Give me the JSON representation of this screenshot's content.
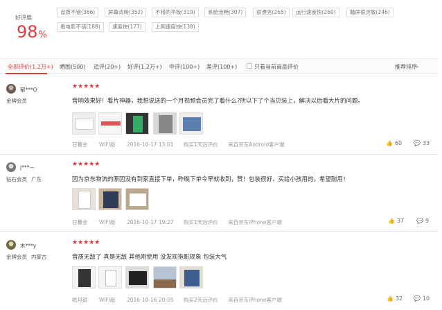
{
  "summary": {
    "label": "好评度",
    "value": "98",
    "percent": "%"
  },
  "tags": [
    "音质不错(366)",
    "屏幕清晰(352)",
    "不错的平板(319)",
    "系统流畅(307)",
    "很漂亮(265)",
    "运行速度快(260)",
    "触屏很灵敏(246)",
    "看电影不错(188)",
    "速度快(177)",
    "上网速度快(138)"
  ],
  "filters": {
    "all": "全部评价(1.2万+)",
    "pics": "晒图(500)",
    "append": "追评(20+)",
    "good": "好评(1.2万+)",
    "mid": "中评(100+)",
    "bad": "差评(100+)",
    "current_only": "只看当前商品评价",
    "sort": "推荐排序"
  },
  "icons": {
    "star": "★",
    "like": "👍",
    "comment": "💬",
    "caret": "⌄"
  },
  "reviews": [
    {
      "user": "郁***O",
      "level": "金牌会员",
      "location": "",
      "stars": "★★★★★",
      "text": "音响效果好！看片神器，我想说送的一个月视频会员完了看什么?所以下了个当贝装上，解决以后看大片的问题。",
      "meta": {
        "color": "日暮金",
        "model": "WIFI版",
        "date": "2016-10-17 13:01",
        "after": "购买1天后评价",
        "client": "来自京东Android客户端"
      },
      "likes": "60",
      "comments": "33"
    },
    {
      "user": "j***—",
      "level": "钻石会员",
      "location": "广东",
      "stars": "★★★★★",
      "text": "因为京东物流的原因没有到家直接下单，昨晚下单今早就收到，赞！包装很好，买给小孩用的，希望耐用！",
      "meta": {
        "color": "日暮金",
        "model": "WIFI版",
        "date": "2016-10-17 19:27",
        "after": "购买1天后评价",
        "client": "来自京东iPhone客户端"
      },
      "likes": "37",
      "comments": "9"
    },
    {
      "user": "木***y",
      "level": "金牌会员",
      "location": "内蒙古",
      "stars": "★★★★★",
      "text": "音质无敌了 真是无敌 其他刚使用 没发现拖影现象 包装大气",
      "meta": {
        "color": "皓月银",
        "model": "WIFI版",
        "date": "2016-10-16 20:05",
        "after": "购买2天后评价",
        "client": "来自京东iPhone客户端"
      },
      "likes": "32",
      "comments": "10"
    }
  ]
}
